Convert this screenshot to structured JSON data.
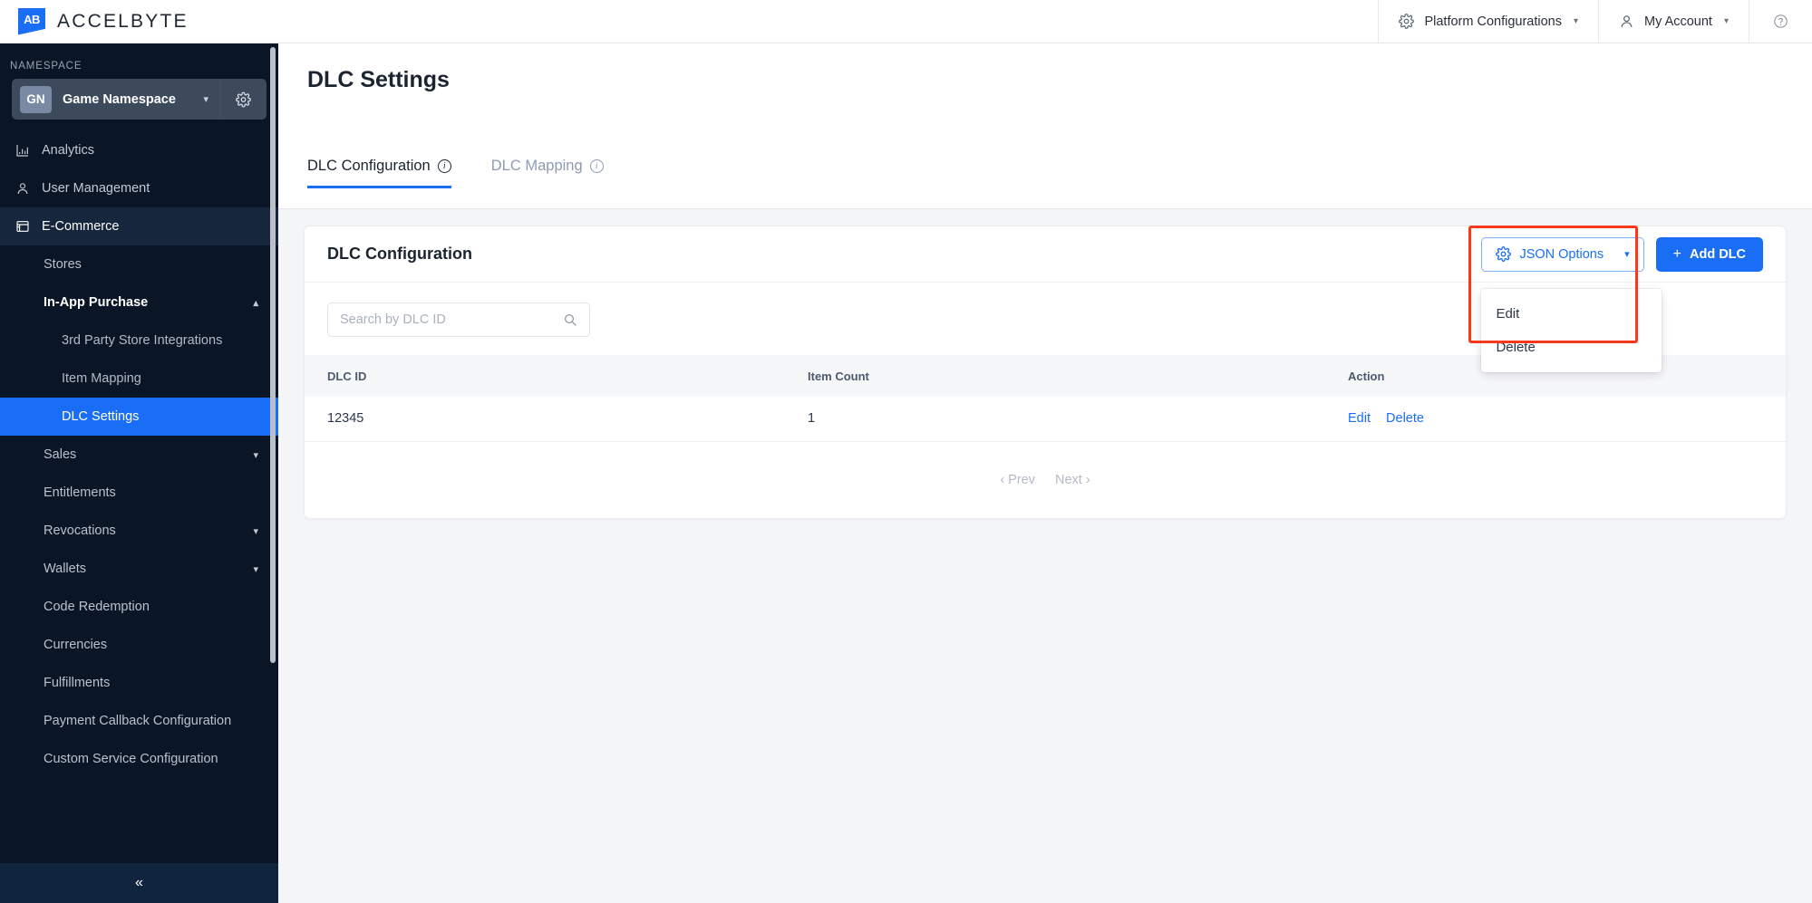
{
  "brand": {
    "mark_text": "AB",
    "name": "ACCELBYTE"
  },
  "topbar": {
    "platform_configurations": "Platform Configurations",
    "my_account": "My Account",
    "help_glyph": "?"
  },
  "sidebar": {
    "namespace_label": "NAMESPACE",
    "namespace": {
      "badge": "GN",
      "name": "Game Namespace"
    },
    "items": [
      {
        "label": "Analytics",
        "icon": "bar-chart-icon",
        "level": 1
      },
      {
        "label": "User Management",
        "icon": "person-icon",
        "level": 1
      },
      {
        "label": "E-Commerce",
        "icon": "storefront-icon",
        "level": 1,
        "state": "section-active"
      },
      {
        "label": "Stores",
        "level": 2
      },
      {
        "label": "In-App Purchase",
        "level": 2,
        "chevron": "up",
        "expanded": true
      },
      {
        "label": "3rd Party Store Integrations",
        "level": 3
      },
      {
        "label": "Item Mapping",
        "level": 3
      },
      {
        "label": "DLC Settings",
        "level": 3,
        "state": "selected"
      },
      {
        "label": "Sales",
        "level": 2,
        "chevron": "down"
      },
      {
        "label": "Entitlements",
        "level": 2
      },
      {
        "label": "Revocations",
        "level": 2,
        "chevron": "down"
      },
      {
        "label": "Wallets",
        "level": 2,
        "chevron": "down"
      },
      {
        "label": "Code Redemption",
        "level": 2
      },
      {
        "label": "Currencies",
        "level": 2
      },
      {
        "label": "Fulfillments",
        "level": 2
      },
      {
        "label": "Payment Callback Configuration",
        "level": 2
      },
      {
        "label": "Custom Service Configuration",
        "level": 2
      }
    ],
    "collapse_glyph": "«"
  },
  "page": {
    "title": "DLC Settings",
    "tabs": [
      {
        "label": "DLC Configuration",
        "active": true,
        "info": true
      },
      {
        "label": "DLC Mapping",
        "active": false,
        "info": true
      }
    ]
  },
  "card": {
    "title": "DLC Configuration",
    "json_options_button": "JSON Options",
    "add_dlc_button": "Add DLC",
    "add_plus": "+",
    "dropdown_items": [
      "Edit",
      "Delete"
    ]
  },
  "search": {
    "placeholder": "Search by DLC ID",
    "value": ""
  },
  "table": {
    "columns": [
      "DLC ID",
      "Item Count",
      "Action"
    ],
    "rows": [
      {
        "dlc_id": "12345",
        "item_count": "1",
        "actions": [
          "Edit",
          "Delete"
        ]
      }
    ]
  },
  "pagination": {
    "prev": "‹ Prev",
    "next": "Next ›"
  },
  "colors": {
    "accent_blue": "#1a6ef5",
    "sidebar_bg": "#0a1526",
    "annotation_red": "#f8381d",
    "page_bg": "#f4f5f7"
  }
}
